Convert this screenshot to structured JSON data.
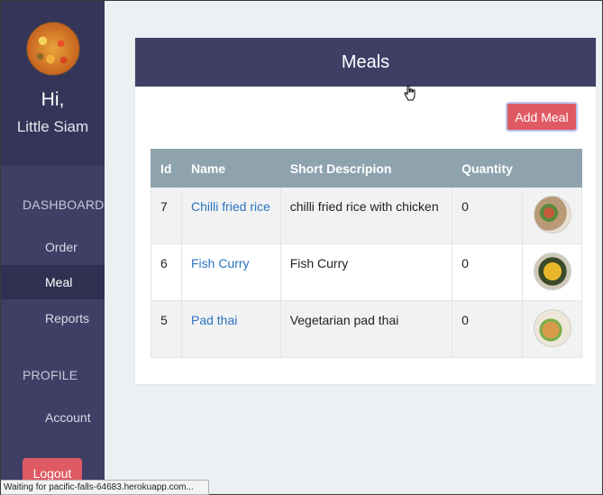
{
  "sidebar": {
    "greeting": "Hi,",
    "restaurant_name": "Little Siam",
    "dashboard_label": "DASHBOARD",
    "nav_items": [
      {
        "label": "Order"
      },
      {
        "label": "Meal",
        "active": true
      },
      {
        "label": "Reports"
      }
    ],
    "profile_label": "PROFILE",
    "profile_items": [
      {
        "label": "Account"
      }
    ],
    "logout_label": "Logout"
  },
  "panel": {
    "title": "Meals",
    "add_button_label": "Add Meal"
  },
  "table": {
    "headers": [
      "Id",
      "Name",
      "Short Descripion",
      "Quantity",
      ""
    ],
    "rows": [
      {
        "id": "7",
        "name": "Chilli fried rice",
        "description": "chilli fried rice with chicken",
        "quantity": "0"
      },
      {
        "id": "6",
        "name": "Fish Curry",
        "description": "Fish Curry",
        "quantity": "0"
      },
      {
        "id": "5",
        "name": "Pad thai",
        "description": "Vegetarian pad thai",
        "quantity": "0"
      }
    ]
  },
  "status_bar": {
    "text": "Waiting for pacific-falls-64683.herokuapp.com..."
  },
  "colors": {
    "sidebar_bg": "#3f3f66",
    "accent_red": "#e05a63",
    "table_header": "#8fa3af",
    "link_blue": "#2a74c2"
  }
}
